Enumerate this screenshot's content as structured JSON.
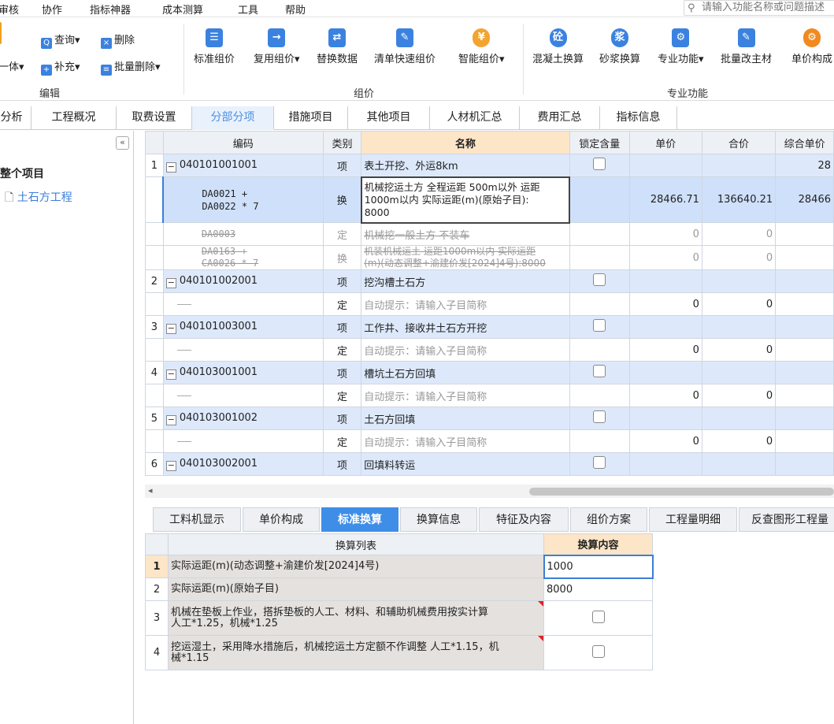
{
  "menubar": {
    "items": [
      "审核",
      "协作",
      "指标神器",
      "成本测算",
      "工具",
      "帮助"
    ],
    "search_placeholder": "请输入功能名称或问题描述"
  },
  "ribbon": {
    "edit": {
      "items": [
        "一体",
        "查询",
        "补充",
        "删除",
        "批量删除"
      ],
      "group": "编辑"
    },
    "pricing": {
      "buttons": [
        "标准组价",
        "复用组价",
        "替换数据",
        "清单快速组价",
        "智能组价"
      ],
      "group": "组价"
    },
    "special": {
      "buttons": [
        "混凝土换算",
        "砂浆换算",
        "专业功能",
        "批量改主材",
        "单价构成"
      ],
      "group": "专业功能",
      "icons": [
        "砼",
        "浆"
      ]
    }
  },
  "tabs": [
    "分析",
    "工程概况",
    "取费设置",
    "分部分项",
    "措施项目",
    "其他项目",
    "人材机汇总",
    "费用汇总",
    "指标信息"
  ],
  "tree": {
    "root": "整个项目",
    "child": "土石方工程"
  },
  "grid": {
    "headers": [
      "编码",
      "类别",
      "名称",
      "锁定含量",
      "单价",
      "合价",
      "综合单价"
    ],
    "rows": [
      {
        "no": "1",
        "code": "040101001001",
        "type": "项",
        "name": "表土开挖、外运8km",
        "unit": "",
        "total": "",
        "comp": "28"
      },
      {
        "code": "DA0021 + DA0022 * 7",
        "code1": "DA0021 +",
        "code2": "DA0022 * 7",
        "type": "换",
        "name": "机械挖运土方 全程运距 500m以外 运距1000m以内  实际运距(m)(原始子目):8000",
        "name1": "机械挖运土方 全程运距 500m以外 运距",
        "name2": "1000m以内  实际运距(m)(原始子目):",
        "name3": "8000",
        "unit": "28466.71",
        "total": "136640.21",
        "comp": "28466"
      },
      {
        "code": "DA0003",
        "type": "定",
        "name": "机械挖一般土方 不装车",
        "unit": "0",
        "total": "0",
        "comp": ""
      },
      {
        "code": "DA0163 + CA0026 * 7",
        "code1": "DA0163 +",
        "code2": "CA0026 * 7",
        "type": "换",
        "name": "机装机械运土 运距1000m以内  实际运距(m)(动态调整+渝建价发[2024]4号):8000",
        "name1": "机装机械运土 运距1000m以内  实际运距",
        "name2": "(m)(动态调整+渝建价发[2024]4号):8000",
        "unit": "0",
        "total": "0",
        "comp": ""
      },
      {
        "no": "2",
        "code": "040101002001",
        "type": "项",
        "name": "挖沟槽土石方"
      },
      {
        "type": "定",
        "name": "自动提示：请输入子目简称",
        "unit": "0",
        "total": "0"
      },
      {
        "no": "3",
        "code": "040101003001",
        "type": "项",
        "name": "工作井、接收井土石方开挖"
      },
      {
        "type": "定",
        "name": "自动提示：请输入子目简称",
        "unit": "0",
        "total": "0"
      },
      {
        "no": "4",
        "code": "040103001001",
        "type": "项",
        "name": "槽坑土石方回填"
      },
      {
        "type": "定",
        "name": "自动提示：请输入子目简称",
        "unit": "0",
        "total": "0"
      },
      {
        "no": "5",
        "code": "040103001002",
        "type": "项",
        "name": "土石方回填"
      },
      {
        "type": "定",
        "name": "自动提示：请输入子目简称",
        "unit": "0",
        "total": "0"
      },
      {
        "no": "6",
        "code": "040103002001",
        "type": "项",
        "name": "回填料转运"
      }
    ]
  },
  "btabs": [
    "工料机显示",
    "单价构成",
    "标准换算",
    "换算信息",
    "特征及内容",
    "组价方案",
    "工程量明细",
    "反查图形工程量"
  ],
  "bgrid": {
    "headers": [
      "换算列表",
      "换算内容"
    ],
    "rows": [
      {
        "no": "1",
        "text": "实际运距(m)(动态调整+渝建价发[2024]4号)",
        "value": "1000"
      },
      {
        "no": "2",
        "text": "实际运距(m)(原始子目)",
        "value": "8000"
      },
      {
        "no": "3",
        "text": "机械在垫板上作业，搭拆垫板的人工、材料、和辅助机械费用按实计算 人工*1.25，机械*1.25",
        "text1": "机械在垫板上作业，搭拆垫板的人工、材料、和辅助机械费用按实计算",
        "text2": "人工*1.25，机械*1.25"
      },
      {
        "no": "4",
        "text": "挖运湿土，采用降水措施后，机械挖运土方定额不作调整 人工*1.15，机械*1.15",
        "text1": "挖运湿土，采用降水措施后，机械挖运土方定额不作调整 人工*1.15，机",
        "text2": "械*1.15"
      }
    ]
  }
}
